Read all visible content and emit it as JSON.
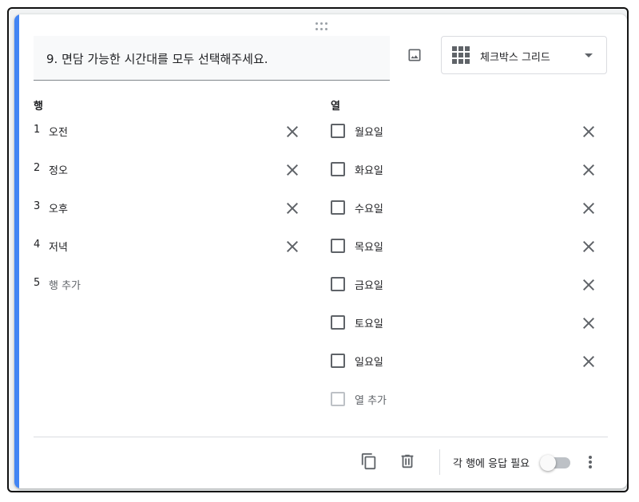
{
  "question": {
    "title": "9. 면담 가능한 시간대를 모두 선택해주세요.",
    "type_label": "체크박스 그리드",
    "type_icon": "grid-icon"
  },
  "rows": {
    "heading": "행",
    "items": [
      {
        "num": "1",
        "label": "오전"
      },
      {
        "num": "2",
        "label": "정오"
      },
      {
        "num": "3",
        "label": "오후"
      },
      {
        "num": "4",
        "label": "저녁"
      }
    ],
    "add": {
      "num": "5",
      "label": "행 추가"
    }
  },
  "columns": {
    "heading": "열",
    "items": [
      {
        "label": "월요일"
      },
      {
        "label": "화요일"
      },
      {
        "label": "수요일"
      },
      {
        "label": "목요일"
      },
      {
        "label": "금요일"
      },
      {
        "label": "토요일"
      },
      {
        "label": "일요일"
      }
    ],
    "add": {
      "label": "열 추가"
    }
  },
  "footer": {
    "required_label": "각 행에 응답 필요",
    "required_on": false,
    "icons": [
      "copy-icon",
      "delete-icon",
      "more-vert-icon"
    ]
  },
  "colors": {
    "accent": "#4285f4",
    "icon": "#5f6368",
    "divider": "#dadce0",
    "question_bg": "#f8f9fa"
  }
}
